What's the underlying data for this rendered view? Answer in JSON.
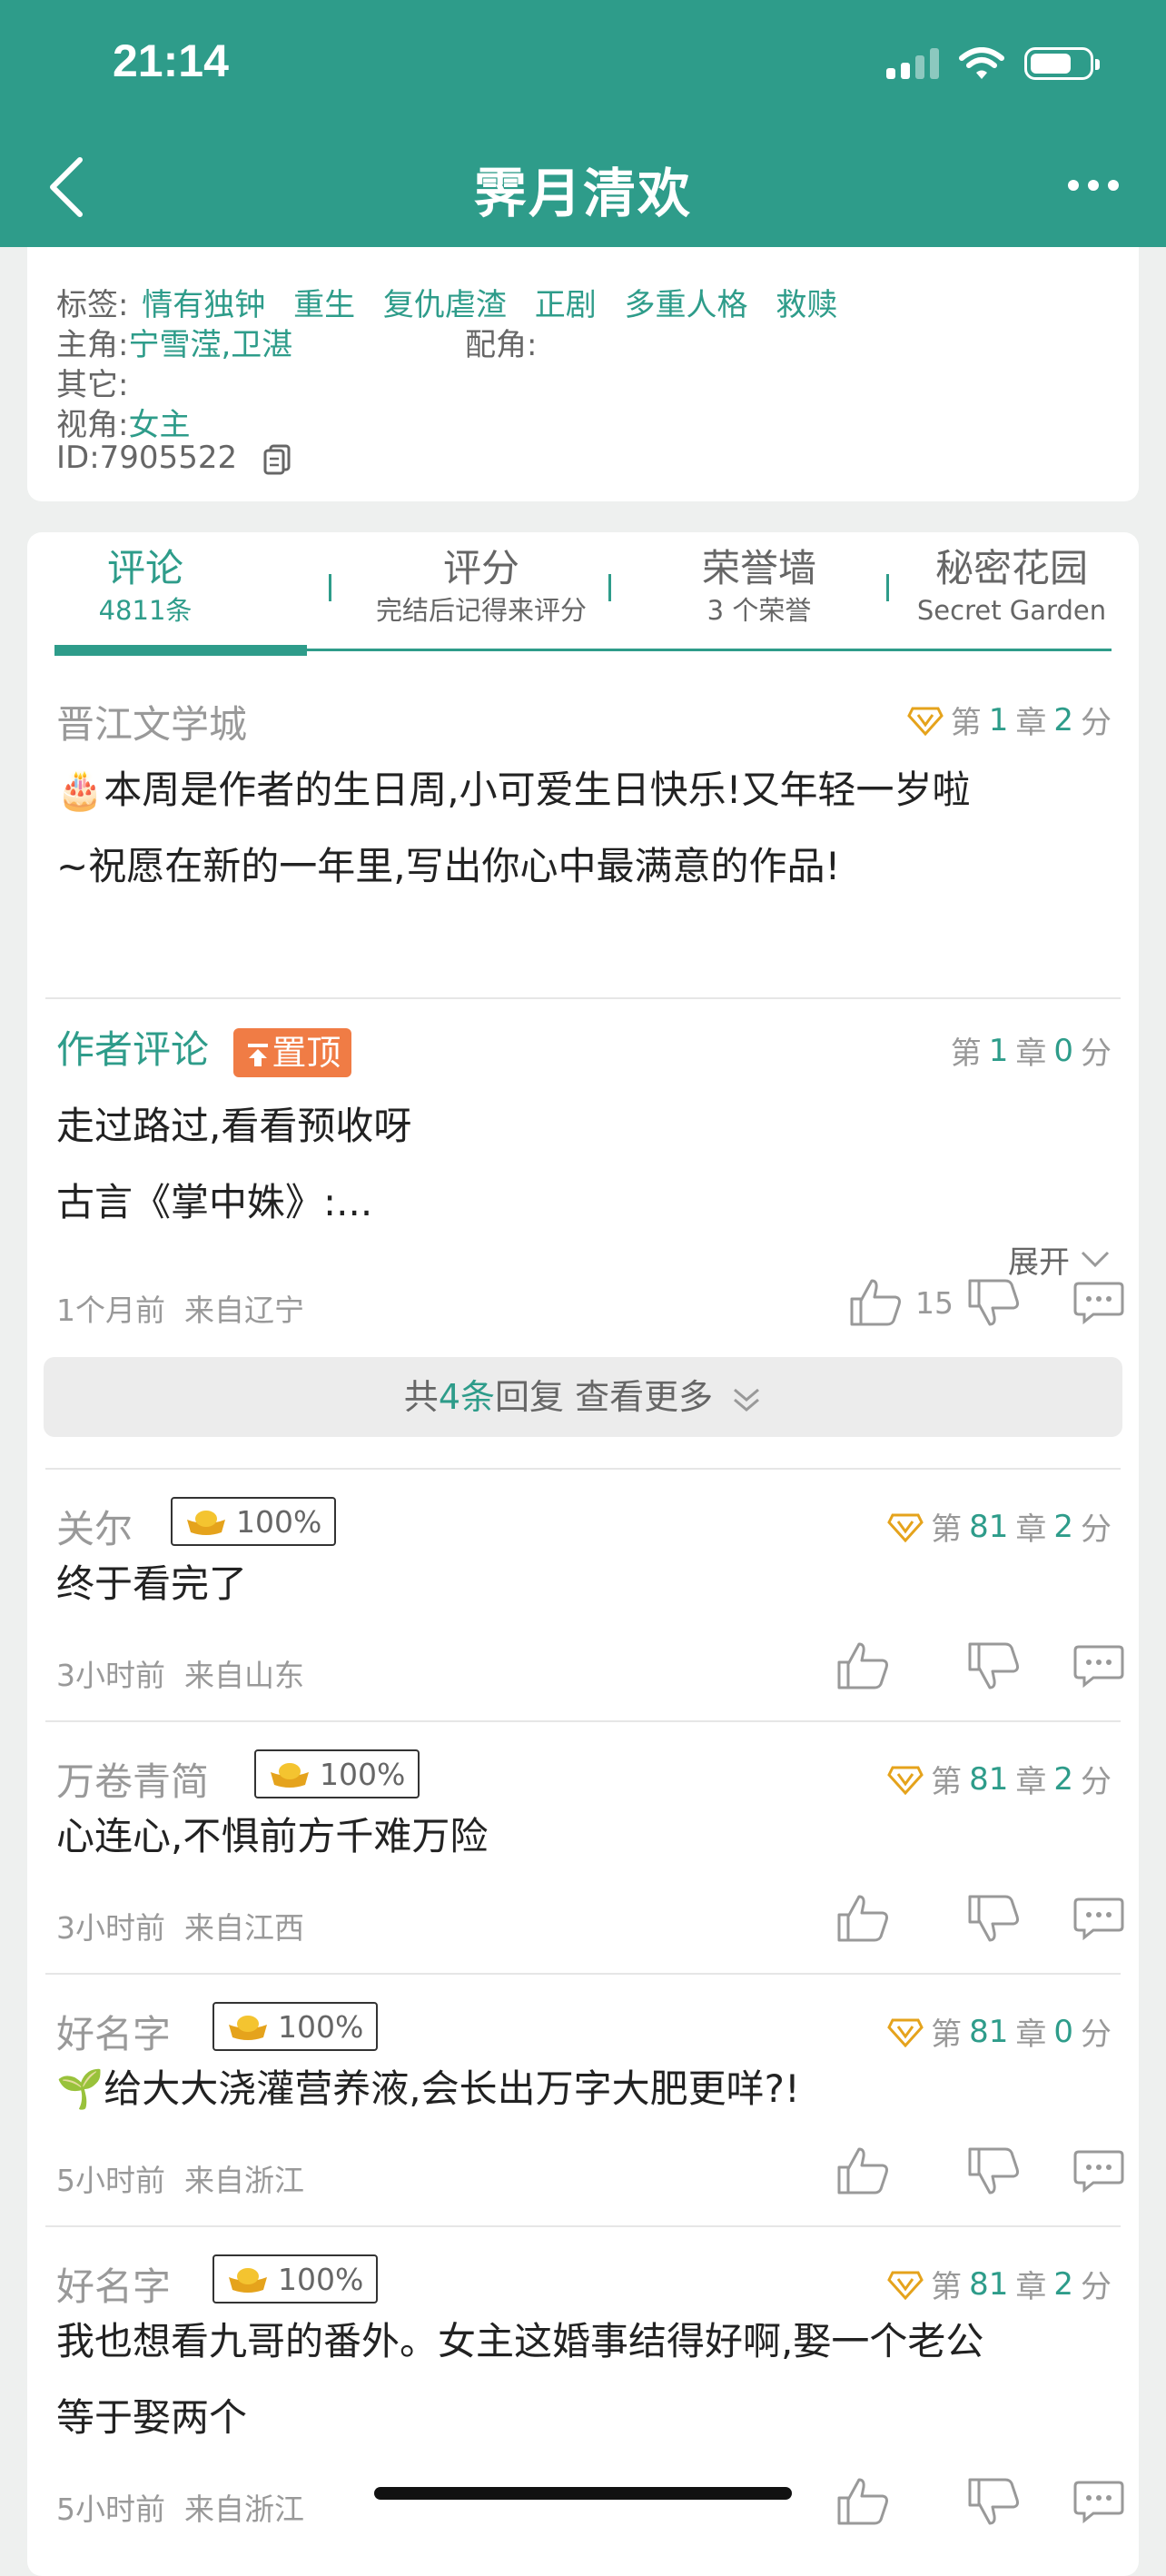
{
  "status_bar": {
    "time": "21:14"
  },
  "header": {
    "title": "霁月清欢"
  },
  "info": {
    "tags_label": "标签:",
    "tags": [
      "情有独钟",
      "重生",
      "复仇虐渣",
      "正剧",
      "多重人格",
      "救赎"
    ],
    "lead_label": "主角:",
    "lead_value": "宁雪滢,卫湛",
    "support_label": "配角:",
    "support_value": "",
    "other_label": "其它:",
    "other_value": "",
    "pov_label": "视角:",
    "pov_value": "女主",
    "id_text": "ID:7905522"
  },
  "tabs": [
    {
      "label": "评论",
      "sub": "4811条"
    },
    {
      "label": "评分",
      "sub": "完结后记得来评分"
    },
    {
      "label": "荣誉墙",
      "sub": "3 个荣誉"
    },
    {
      "label": "秘密花园",
      "sub": "Secret Garden"
    }
  ],
  "comments": [
    {
      "name": "晋江文学城",
      "chapter_prefix": "第",
      "chapter_num": "1",
      "chapter_suffix": "章",
      "score_num": "2",
      "score_suffix": "分",
      "text_line1": "🎂本周是作者的生日周,小可爱生日快乐!又年轻一岁啦",
      "text_line2": "~祝愿在新的一年里,写出你心中最满意的作品!"
    },
    {
      "name": "作者评论",
      "pin_label": "置顶",
      "chapter_prefix": "第",
      "chapter_num": "1",
      "chapter_suffix": "章",
      "score_num": "0",
      "score_suffix": "分",
      "text_line1": "走过路过,看看预收呀",
      "text_line2": "古言《掌中姝》:...",
      "expand_label": "展开",
      "time": "1个月前",
      "location": "来自辽宁",
      "likes": "15",
      "replies_prefix": "共",
      "replies_count": "4条",
      "replies_suffix": "回复 查看更多"
    },
    {
      "name": "关尔",
      "badge": "100%",
      "chapter_prefix": "第",
      "chapter_num": "81",
      "chapter_suffix": "章",
      "score_num": "2",
      "score_suffix": "分",
      "text_line1": "终于看完了",
      "time": "3小时前",
      "location": "来自山东"
    },
    {
      "name": "万卷青简",
      "badge": "100%",
      "chapter_prefix": "第",
      "chapter_num": "81",
      "chapter_suffix": "章",
      "score_num": "2",
      "score_suffix": "分",
      "text_line1": "心连心,不惧前方千难万险",
      "time": "3小时前",
      "location": "来自江西"
    },
    {
      "name": "好名字",
      "badge": "100%",
      "chapter_prefix": "第",
      "chapter_num": "81",
      "chapter_suffix": "章",
      "score_num": "0",
      "score_suffix": "分",
      "text_line1": "🌱给大大浇灌营养液,会长出万字大肥更咩?!",
      "time": "5小时前",
      "location": "来自浙江"
    },
    {
      "name": "好名字",
      "badge": "100%",
      "chapter_prefix": "第",
      "chapter_num": "81",
      "chapter_suffix": "章",
      "score_num": "2",
      "score_suffix": "分",
      "text_line1": "我也想看九哥的番外。女主这婚事结得好啊,娶一个老公",
      "text_line2": "等于娶两个",
      "time": "5小时前",
      "location": "来自浙江"
    }
  ],
  "colors": {
    "brand": "#2e9c8a",
    "pin": "#f07c45",
    "gold": "#e5a31c"
  }
}
